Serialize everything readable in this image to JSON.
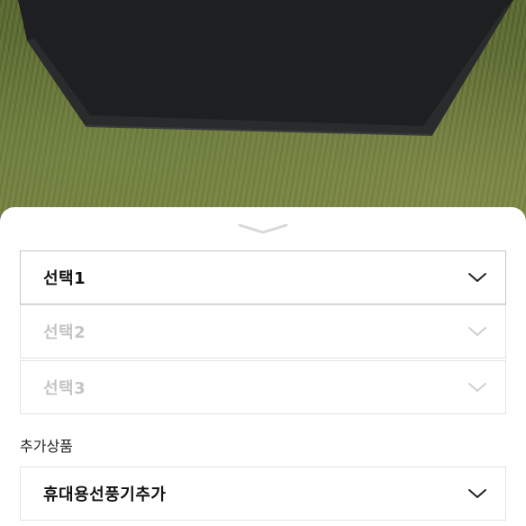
{
  "options": {
    "select1": {
      "label": "선택1",
      "state": "enabled"
    },
    "select2": {
      "label": "선택2",
      "state": "disabled"
    },
    "select3": {
      "label": "선택3",
      "state": "disabled"
    }
  },
  "additional": {
    "title": "추가상품",
    "select": {
      "label": "휴대용선풍기추가"
    }
  },
  "icons": {
    "handle": "chevron-down-icon",
    "dropdown": "chevron-down-icon"
  },
  "colors": {
    "sheet": "#ffffff",
    "border": "#e2e2e2",
    "text": "#111111",
    "disabled_text": "#c4c4c4"
  }
}
